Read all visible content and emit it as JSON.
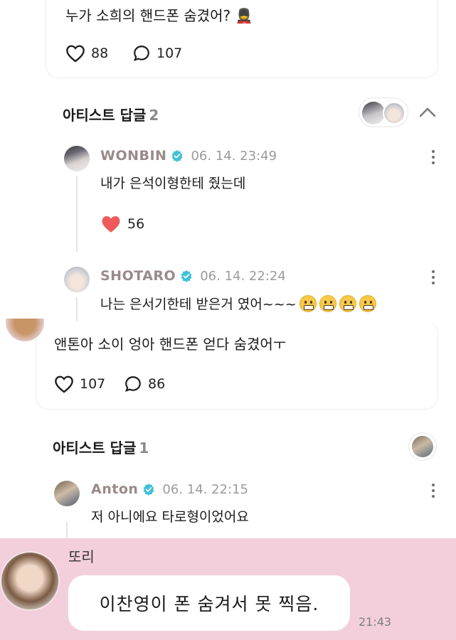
{
  "post_top": {
    "text": "누가 소희의 핸드폰 숨겼어? 💂",
    "likes": "88",
    "comments": "107"
  },
  "artist_replies_1": {
    "title": "아티스트 답글",
    "count": "2",
    "replies": [
      {
        "name": "WONBIN",
        "time": "06. 14. 23:49",
        "text": "내가 은석이형한테 줬는데",
        "likes": "56"
      },
      {
        "name": "SHOTARO",
        "time": "06. 14. 22:24",
        "text": "나는 은서기한테 받은거 였어~~~"
      }
    ]
  },
  "post_mid": {
    "text": "앤톤아 소이 엉아 핸드폰 얻다 숨겼어ㅜ",
    "likes": "107",
    "comments": "86"
  },
  "artist_replies_2": {
    "title": "아티스트 답글",
    "count": "1",
    "replies": [
      {
        "name": "Anton",
        "time": "06. 14. 22:15",
        "text": "저 아니에요 타로형이었어요"
      }
    ]
  },
  "chat": {
    "sender": "또리",
    "message": "이찬영이 폰 숨겨서 못 찍음.",
    "time": "21:43"
  },
  "colors": {
    "chat_background": "#f2cfda",
    "verified_badge": "#3fc0d6",
    "heart_filled": "#ef5b5b",
    "name_text": "#9a8a8a"
  }
}
